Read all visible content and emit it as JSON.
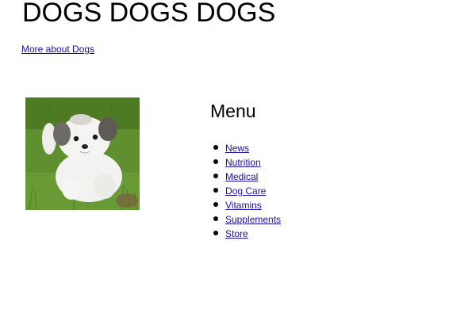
{
  "header": {
    "title": "DOGS DOGS DOGS",
    "more_link": "More about Dogs"
  },
  "photo": {
    "subject": "puppy-photo"
  },
  "menu": {
    "heading": "Menu",
    "items": [
      {
        "label": "News"
      },
      {
        "label": "Nutrition"
      },
      {
        "label": "Medical"
      },
      {
        "label": "Dog Care"
      },
      {
        "label": "Vitamins"
      },
      {
        "label": "Supplements"
      },
      {
        "label": "Store"
      }
    ]
  },
  "colors": {
    "link": "#1a0dab",
    "text": "#000000",
    "background": "#ffffff"
  }
}
